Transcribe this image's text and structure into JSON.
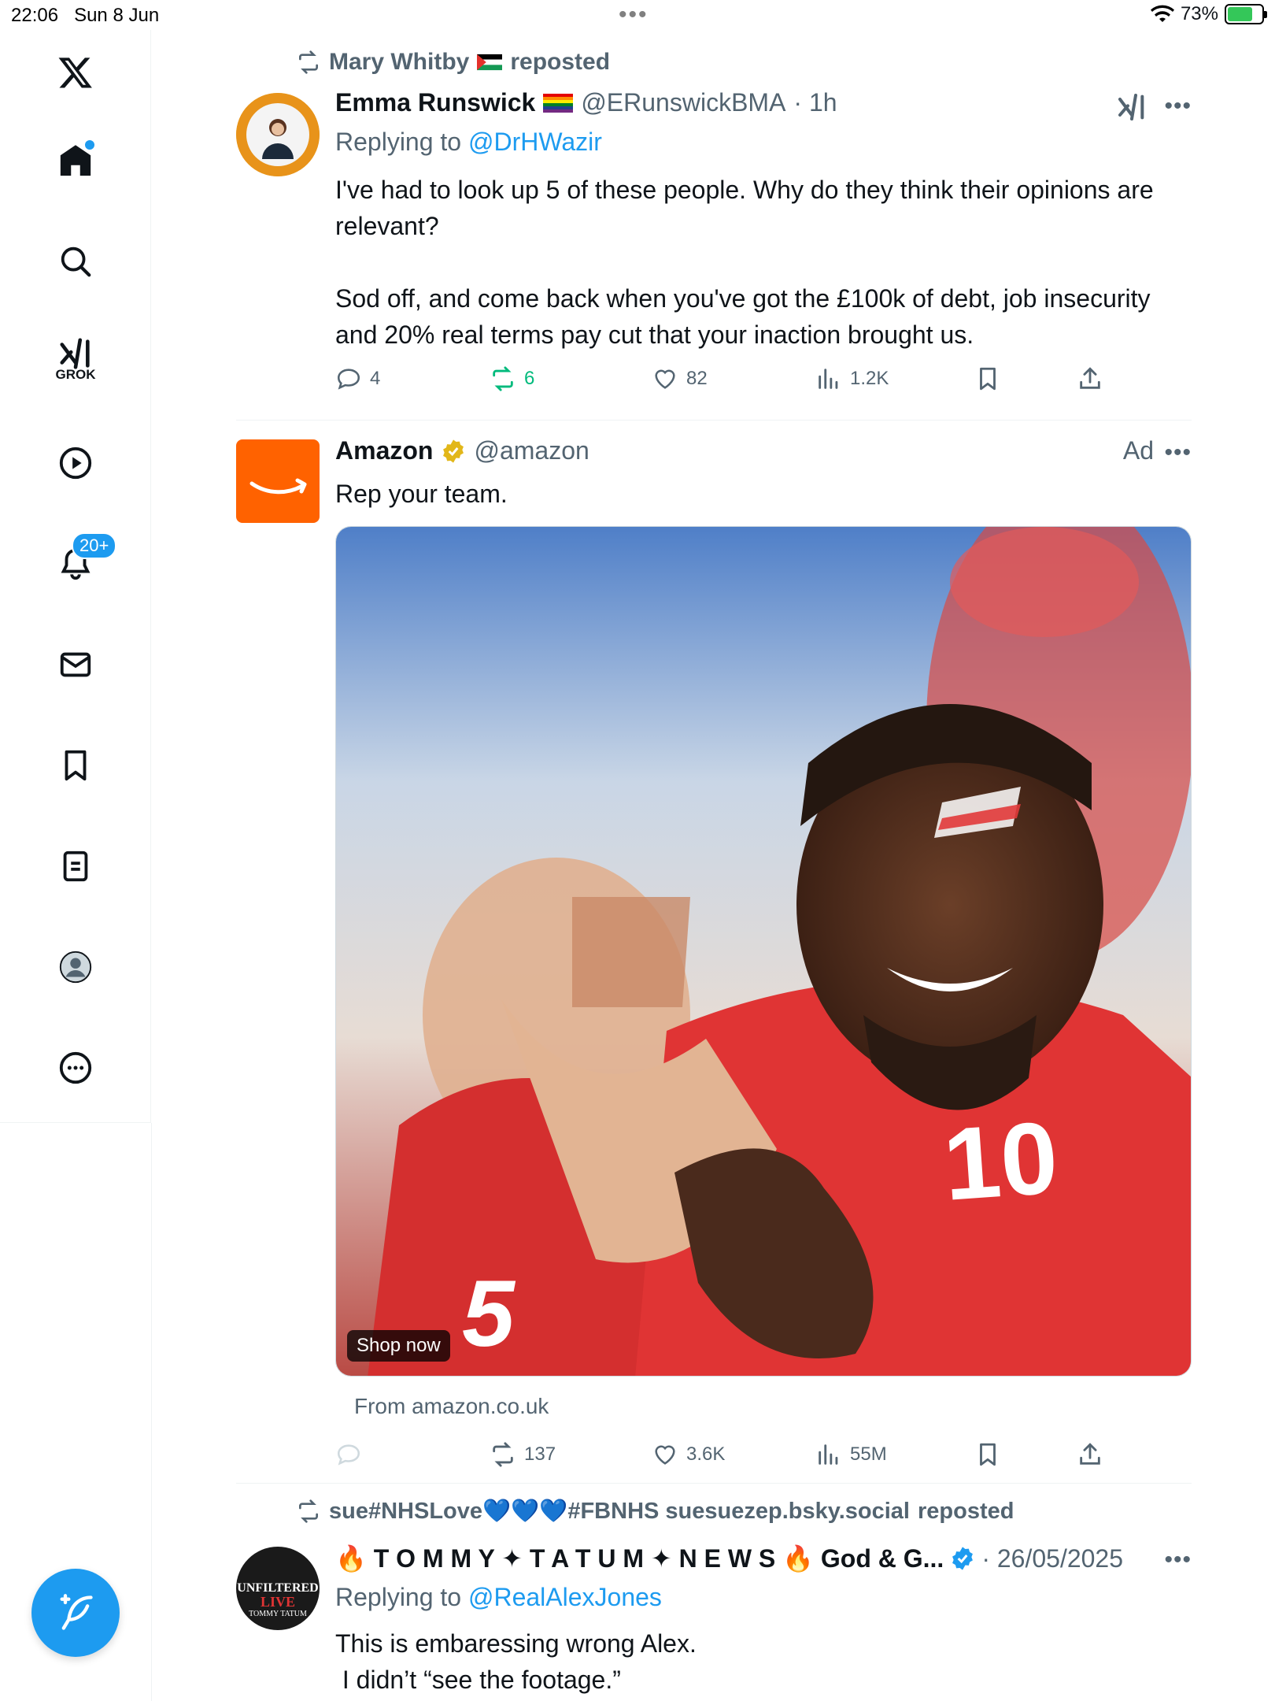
{
  "status_bar": {
    "time": "22:06",
    "date": "Sun 8 Jun",
    "dots": "•••",
    "battery": "73%"
  },
  "sidebar": {
    "grok_label": "GROK",
    "notifications_badge": "20+"
  },
  "tweets": [
    {
      "reposted_by": "Mary Whitby",
      "reposted_suffix": "reposted",
      "name": "Emma Runswick",
      "handle": "@ERunswickBMA",
      "time": "· 1h",
      "more": "•••",
      "replying_label": "Replying to",
      "replying_to": "@DrHWazir",
      "text_p1": "I've had to look up 5 of these people. Why do they think their opinions are relevant?",
      "text_p2": "Sod off, and come back when you've got the £100k of debt, job insecurity and 20% real terms pay cut that your inaction brought us.",
      "replies": "4",
      "reposts": "6",
      "likes": "82",
      "views": "1.2K"
    },
    {
      "name": "Amazon",
      "handle": "@amazon",
      "ad_label": "Ad",
      "more": "•••",
      "text": "Rep your team.",
      "image_alt": "Football fans cheering in red shirts",
      "shirt_number_front": "10",
      "shirt_number_back": "5",
      "shop_now": "Shop now",
      "source": "From amazon.co.uk",
      "reposts": "137",
      "likes": "3.6K",
      "views": "55M"
    },
    {
      "reposted_by": "sue#NHSLove💙💙💙#FBNHS suesuezep.bsky.social",
      "reposted_suffix": "reposted",
      "name": "🔥 T O M M Y ✦ T A T U M ✦ N E W S 🔥 God & G...",
      "date": "· 26/05/2025",
      "more": "•••",
      "avatar_text_1": "UNFILTERED",
      "avatar_text_2": "LIVE",
      "avatar_text_3": "TOMMY TATUM",
      "replying_label": "Replying to",
      "replying_to": "@RealAlexJones",
      "text_line1": "This is embaressing wrong Alex.",
      "text_line2": " I didn’t “see the footage.”"
    }
  ],
  "colors": {
    "accent": "#1d9bf0",
    "repost_green": "#00ba7c",
    "amazon_orange": "#ff6200",
    "muted": "#536471"
  }
}
